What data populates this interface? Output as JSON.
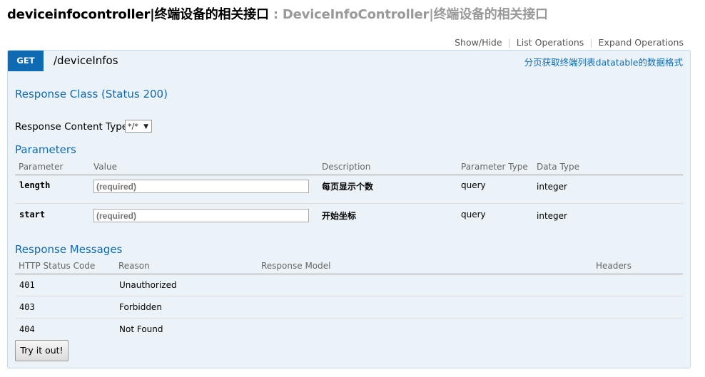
{
  "header": {
    "controller_name": "deviceinfocontroller|终端设备的相关接口",
    "separator": ":",
    "controller_description": "DeviceInfoController|终端设备的相关接口"
  },
  "operations_links": [
    "Show/Hide",
    "List Operations",
    "Expand Operations"
  ],
  "endpoint": {
    "method": "GET",
    "path": "/deviceInfos",
    "summary": "分页获取终端列表datatable的数据格式",
    "response_class_title": "Response Class (Status 200)",
    "content_type_label": "Response Content Type",
    "content_type_value": "*/*",
    "parameters_title": "Parameters",
    "parameter_headers": [
      "Parameter",
      "Value",
      "Description",
      "Parameter Type",
      "Data Type"
    ],
    "parameters": [
      {
        "name": "length",
        "placeholder": "(required)",
        "description": "每页显示个数",
        "param_type": "query",
        "data_type": "integer"
      },
      {
        "name": "start",
        "placeholder": "(required)",
        "description": "开始坐标",
        "param_type": "query",
        "data_type": "integer"
      }
    ],
    "response_messages_title": "Response Messages",
    "response_headers": [
      "HTTP Status Code",
      "Reason",
      "Response Model",
      "Headers"
    ],
    "responses": [
      {
        "code": "401",
        "reason": "Unauthorized"
      },
      {
        "code": "403",
        "reason": "Forbidden"
      },
      {
        "code": "404",
        "reason": "Not Found"
      }
    ],
    "try_button": "Try it out!"
  },
  "colors": {
    "accent_blue": "#0f6ab4",
    "panel_bg": "#ebf3f9",
    "panel_border": "#c3d9ec"
  }
}
